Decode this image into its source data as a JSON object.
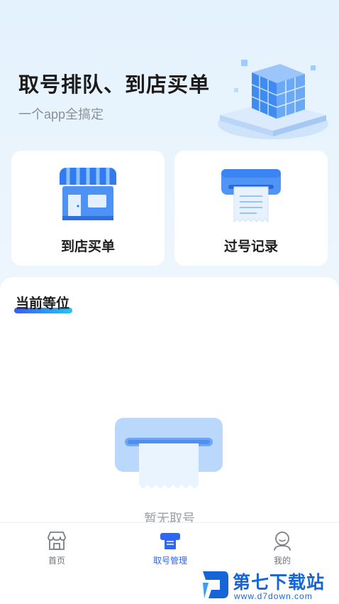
{
  "hero": {
    "title": "取号排队、到店买单",
    "subtitle": "一个app全搞定",
    "art_icon": "cube-stack-illustration"
  },
  "cards": [
    {
      "label": "到店买单",
      "icon": "storefront-icon"
    },
    {
      "label": "过号记录",
      "icon": "receipt-printer-icon"
    }
  ],
  "current_queue": {
    "title": "当前等位",
    "empty_text": "暂无取号",
    "empty_icon": "ticket-dispenser-icon"
  },
  "tabbar": {
    "items": [
      {
        "label": "首页",
        "icon": "shop-icon",
        "active": false
      },
      {
        "label": "取号管理",
        "icon": "ticket-icon",
        "active": true
      },
      {
        "label": "我的",
        "icon": "user-icon",
        "active": false
      }
    ]
  },
  "watermark": {
    "name": "第七下载站",
    "url": "www.d7down.com"
  },
  "colors": {
    "accent": "#2f66f0",
    "hero_bg": "#e4f2fd",
    "watermark": "#1565d8"
  }
}
